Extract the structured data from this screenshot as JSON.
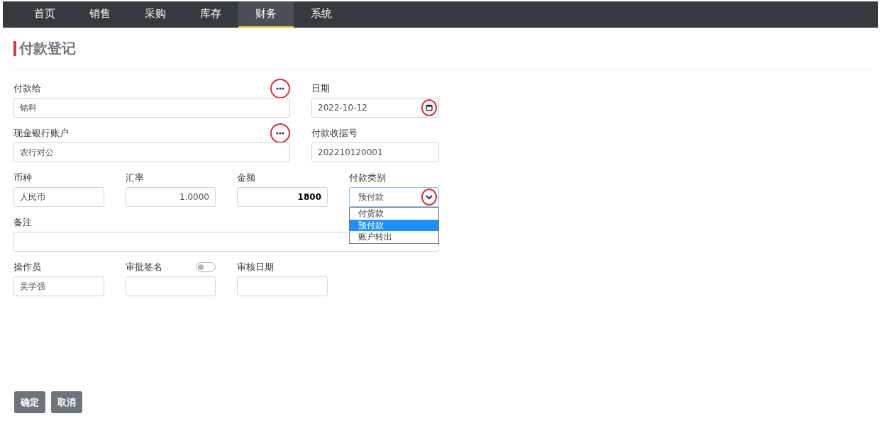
{
  "nav": [
    {
      "label": "首页",
      "selected": false
    },
    {
      "label": "销售",
      "selected": false
    },
    {
      "label": "采购",
      "selected": false
    },
    {
      "label": "库存",
      "selected": false
    },
    {
      "label": "财务",
      "selected": true
    },
    {
      "label": "系统",
      "selected": false
    }
  ],
  "title": "付款登记",
  "rows": [
    {
      "fields": [
        {
          "kind": "lookup",
          "label": "付款给",
          "value": "铭科"
        },
        {
          "kind": "date",
          "label": "日期",
          "value": "2022-10-12"
        }
      ]
    },
    {
      "fields": [
        {
          "kind": "lookup",
          "label": "现金银行账户",
          "value": "农行对公"
        },
        {
          "kind": "text",
          "label": "付款收据号",
          "value": "202210120001"
        }
      ]
    },
    {
      "fields": [
        {
          "kind": "text",
          "label": "币种",
          "value": "人民币"
        },
        {
          "kind": "number",
          "label": "汇率",
          "value": "1.0000"
        },
        {
          "kind": "amount",
          "label": "金额",
          "value": "1800"
        },
        {
          "kind": "select",
          "label": "付款类别",
          "value": "预付款",
          "expanded": true,
          "options": [
            {
              "label": "付货款",
              "selected": false
            },
            {
              "label": "预付款",
              "selected": true
            },
            {
              "label": "账户转出",
              "selected": false
            }
          ]
        }
      ]
    },
    {
      "fields": [
        {
          "kind": "text",
          "label": "备注"
        }
      ]
    },
    {
      "fields": [
        {
          "kind": "text",
          "label": "操作员",
          "value": "吴学强"
        },
        {
          "kind": "signature",
          "label": "审批签名",
          "on": false
        },
        {
          "kind": "text",
          "label": "审核日期"
        }
      ]
    }
  ],
  "buttons": [
    "确定",
    "取消"
  ]
}
